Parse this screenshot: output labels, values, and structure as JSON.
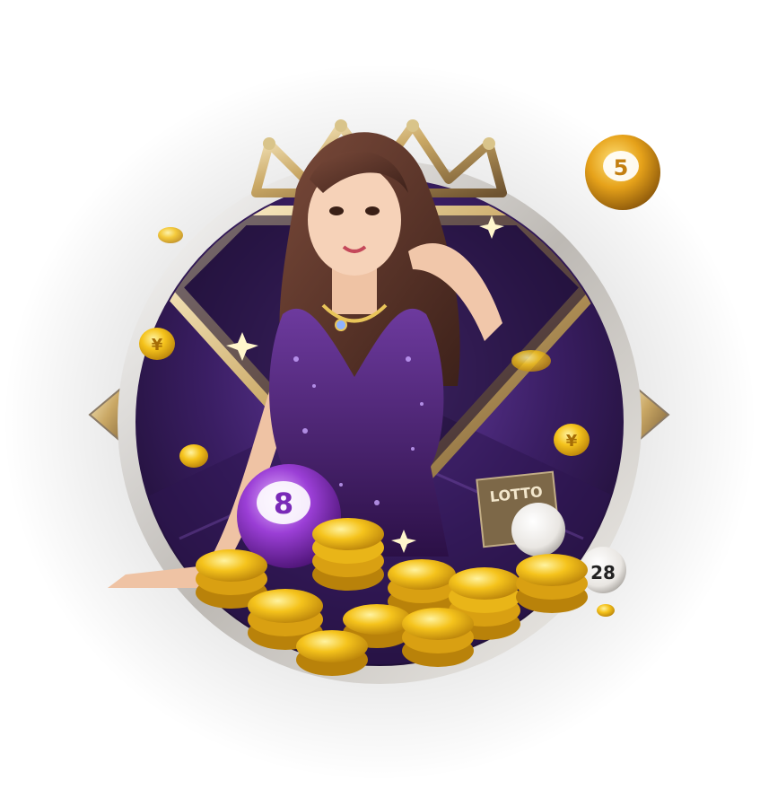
{
  "scene": {
    "ball_labels": {
      "purple_ball": "8",
      "gold_ball": "5",
      "white_ball": "28"
    },
    "lotto_card_text": "LOTTO",
    "coin_symbol": "¥",
    "colors": {
      "purple_dark": "#2a1440",
      "purple_mid": "#5c2d8a",
      "gold": "#f5c31c",
      "gold_dark": "#b9820a",
      "silver": "#d9d6d2"
    }
  }
}
